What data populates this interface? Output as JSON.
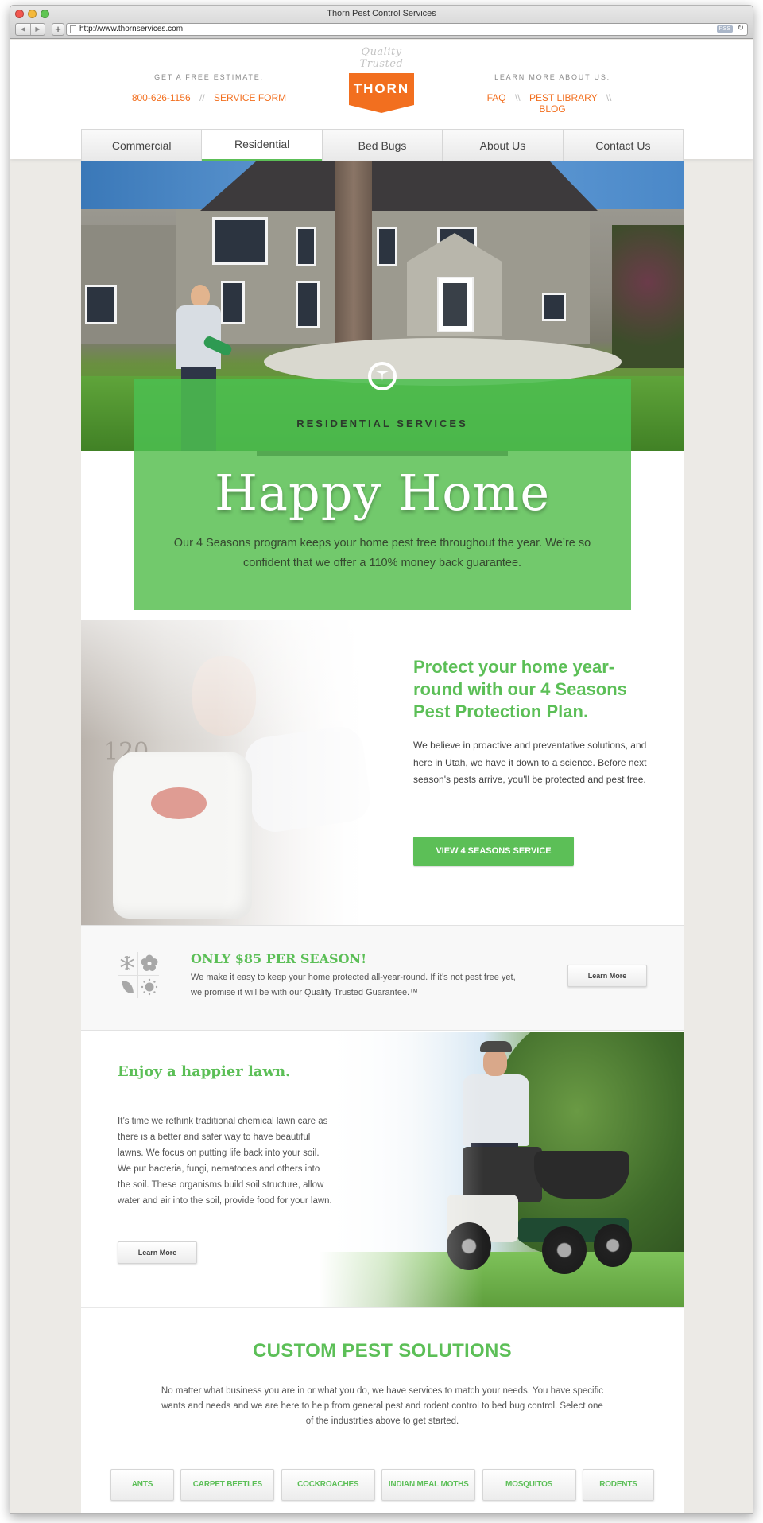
{
  "browser": {
    "window_title": "Thorn Pest Control Services",
    "url": "http://www.thornservices.com",
    "rss_label": "RSS",
    "reload_icon": "↻",
    "back_icon": "◀",
    "forward_icon": "▶",
    "add_icon": "+"
  },
  "header": {
    "left": {
      "label": "GET A FREE ESTIMATE:",
      "phone": "800-626-1156",
      "separator": "//",
      "service_form": "SERVICE FORM"
    },
    "logo": {
      "tagline": "Quality Trusted",
      "name": "THORN"
    },
    "right": {
      "label": "LEARN MORE ABOUT US:",
      "links": [
        "FAQ",
        "PEST LIBRARY",
        "BLOG"
      ],
      "separator": "\\\\"
    },
    "accent_color": "#f26f1f"
  },
  "nav": {
    "items": [
      {
        "label": "Commercial",
        "active": false
      },
      {
        "label": "Residential",
        "active": true
      },
      {
        "label": "Bed Bugs",
        "active": false
      },
      {
        "label": "About Us",
        "active": false
      },
      {
        "label": "Contact Us",
        "active": false
      }
    ],
    "active_color": "#5cbf57"
  },
  "hero": {
    "kicker": "RESIDENTIAL SERVICES",
    "title": "Happy Home",
    "text": "Our 4 Seasons program keeps your home pest free throughout the year. We’re so confident that we offer a 110% money back guarantee.",
    "icon": "thorn-badge-icon",
    "banner_color": "#72c96c"
  },
  "protect": {
    "heading": "Protect your home year-round with our 4 Seasons Pest Protection Plan.",
    "body": "We believe in proactive and preventative solutions, and here in Utah, we have it down to a science. Before next season's pests arrive, you'll be protected and pest free.",
    "button": "VIEW 4 SEASONS SERVICE",
    "photo_house_number": "120"
  },
  "season": {
    "icons": [
      "snowflake-icon",
      "flower-icon",
      "leaf-icon",
      "sun-icon"
    ],
    "heading": "ONLY $85 PER SEASON!",
    "body": "We make it easy to keep your home protected all-year-round. If it’s not pest free yet, we promise it will be with our Quality Trusted Guarantee.™",
    "button": "Learn More"
  },
  "lawn": {
    "heading": "Enjoy a happier lawn.",
    "body": "It’s time we rethink traditional chemical lawn care as there is a better and safer way to have beautiful lawns. We focus on putting life back into your soil. We put bacteria, fungi, nematodes and others into the soil. These organisms build soil structure, allow water and air into the soil, provide food for your lawn.",
    "button": "Learn More"
  },
  "custom": {
    "heading": "CUSTOM PEST SOLUTIONS",
    "body": "No matter what business you are in or what you do, we have services to match your needs. You have specific wants and needs and we are here to help from general pest and rodent control to bed bug control. Select one of the industrties above to get started.",
    "pests": [
      "ANTS",
      "CARPET BEETLES",
      "COCKROACHES",
      "INDIAN MEAL MOTHS",
      "MOSQUITOS",
      "RODENTS"
    ]
  }
}
